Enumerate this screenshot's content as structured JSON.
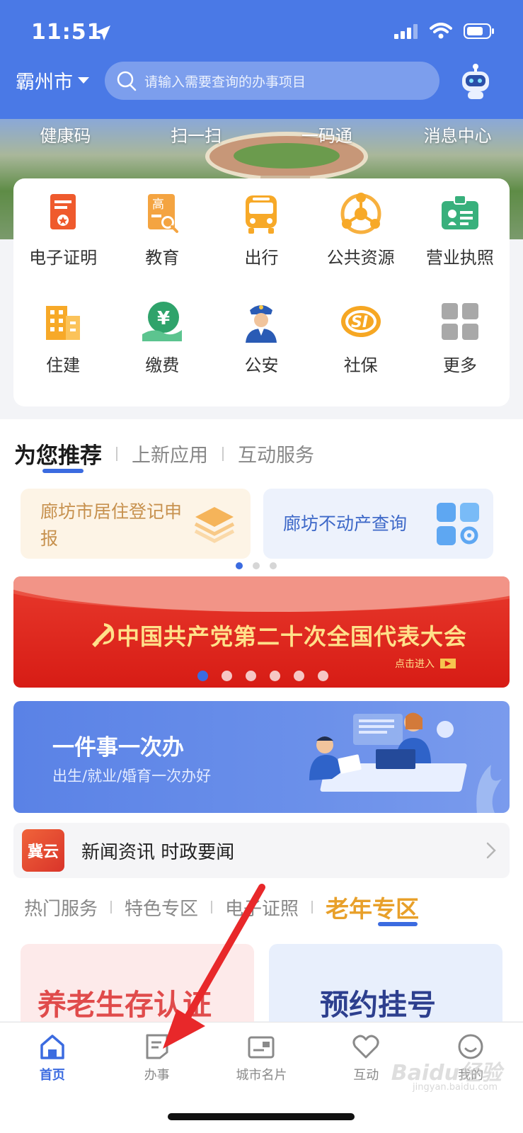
{
  "status_bar": {
    "time": "11:51"
  },
  "top_bar": {
    "city": "霸州市",
    "search_placeholder": "请输入需要查询的办事项目",
    "assistant_icon": "robot-icon"
  },
  "quick_links": [
    "健康码",
    "扫一扫",
    "一码通",
    "消息中心"
  ],
  "services": [
    {
      "label": "电子证明",
      "icon": "certificate-icon"
    },
    {
      "label": "教育",
      "icon": "education-icon"
    },
    {
      "label": "出行",
      "icon": "bus-icon"
    },
    {
      "label": "公共资源",
      "icon": "network-icon"
    },
    {
      "label": "营业执照",
      "icon": "license-icon"
    },
    {
      "label": "住建",
      "icon": "building-icon"
    },
    {
      "label": "缴费",
      "icon": "payment-icon"
    },
    {
      "label": "公安",
      "icon": "police-icon"
    },
    {
      "label": "社保",
      "icon": "social-security-icon"
    },
    {
      "label": "更多",
      "icon": "grid-icon"
    }
  ],
  "recommend_tabs": {
    "active": "为您推荐",
    "others": [
      "上新应用",
      "互动服务"
    ]
  },
  "recommend_cards": [
    {
      "title": "廊坊市居住登记申报"
    },
    {
      "title": "廊坊不动产查询"
    }
  ],
  "party_banner": {
    "title": "中国共产党第二十次全国代表大会",
    "enter_label": "点击进入"
  },
  "one_thing_banner": {
    "title": "一件事一次办",
    "subtitle": "出生/就业/婚育一次办好"
  },
  "news": {
    "logo_text": "冀云",
    "text": "新闻资讯 时政要闻"
  },
  "service_tabs": {
    "items": [
      "热门服务",
      "特色专区",
      "电子证照"
    ],
    "active": "老年专区"
  },
  "service_cards": [
    {
      "title": "养老生存认证"
    },
    {
      "title": "预约挂号"
    }
  ],
  "bottom_nav": [
    {
      "label": "首页",
      "icon": "home-icon",
      "active": true
    },
    {
      "label": "办事",
      "icon": "document-icon",
      "active": false
    },
    {
      "label": "城市名片",
      "icon": "city-card-icon",
      "active": false
    },
    {
      "label": "互动",
      "icon": "heart-icon",
      "active": false
    },
    {
      "label": "我的",
      "icon": "smile-icon",
      "active": false
    }
  ],
  "watermark": {
    "brand": "Baidu经验",
    "url": "jingyan.baidu.com"
  },
  "colors": {
    "primary": "#4a79e6",
    "accent_blue": "#3b6be0",
    "party_red": "#d71c15",
    "gold": "#ffe18a",
    "orange": "#e8a02a"
  }
}
